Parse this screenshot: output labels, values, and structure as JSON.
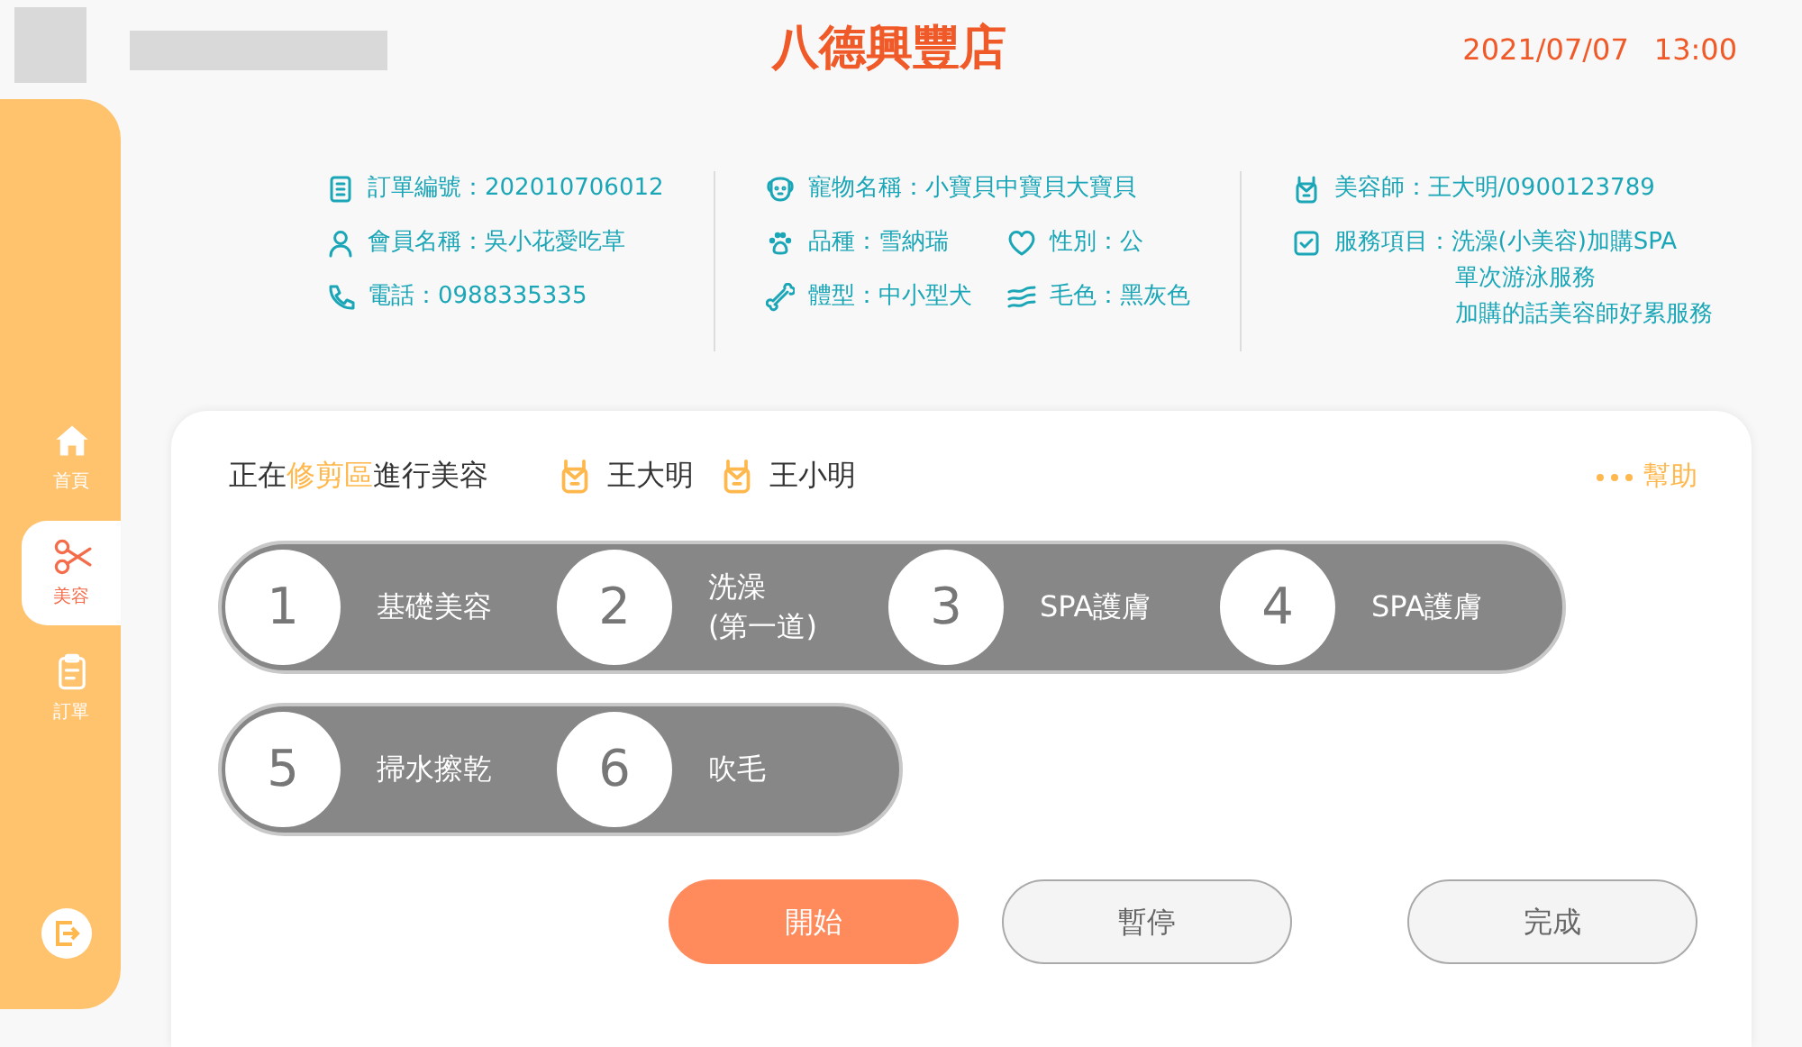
{
  "header": {
    "store_name": "八德興豐店",
    "date": "2021/07/07",
    "time": "13:00"
  },
  "sidebar": {
    "items": [
      {
        "label": "首頁",
        "kind": "home",
        "selected": false
      },
      {
        "label": "美容",
        "kind": "scissors",
        "selected": true
      },
      {
        "label": "訂單",
        "kind": "clipboard",
        "selected": false
      }
    ]
  },
  "info": {
    "columns": [
      [
        {
          "kind": "document",
          "label": "訂單編號：",
          "value": "202010706012"
        },
        {
          "kind": "person",
          "label": "會員名稱：",
          "value": "吳小花愛吃草"
        },
        {
          "kind": "phone",
          "label": "電話：",
          "value": "0988335335"
        }
      ],
      [
        {
          "kind": "dog",
          "label": "寵物名稱：",
          "value": "小寶貝中寶貝大寶貝"
        },
        {
          "kind": "paw",
          "label": "品種：",
          "value": "雪納瑞"
        },
        {
          "kind": "heart",
          "label": "性別：",
          "value": "公"
        },
        {
          "kind": "bone",
          "label": "體型：",
          "value": "中小型犬"
        },
        {
          "kind": "waves",
          "label": "毛色：",
          "value": "黑灰色"
        }
      ],
      [
        {
          "kind": "badge",
          "label": "美容師：",
          "value": "王大明/0900123789"
        },
        {
          "kind": "check",
          "label": "服務項目：",
          "value": "洗澡(小美容)加購SPA",
          "extra": [
            "單次游泳服務",
            "加購的話美容師好累服務"
          ]
        }
      ]
    ]
  },
  "status": {
    "prefix": "正在",
    "area": "修剪區",
    "suffix": "進行美容",
    "groomers": [
      "王大明",
      "王小明"
    ],
    "help": "幫助"
  },
  "steps": [
    [
      {
        "number": "1",
        "label": [
          "基礎美容"
        ]
      },
      {
        "number": "2",
        "label": [
          "洗澡",
          "(第一道)"
        ]
      },
      {
        "number": "3",
        "label": [
          "SPA護膚"
        ]
      },
      {
        "number": "4",
        "label": [
          "SPA護膚"
        ]
      }
    ],
    [
      {
        "number": "5",
        "label": [
          "掃水擦乾"
        ]
      },
      {
        "number": "6",
        "label": [
          "吹毛"
        ]
      }
    ]
  ],
  "buttons": [
    {
      "label": "開始",
      "kind": "primary"
    },
    {
      "label": "暫停",
      "kind": "secondary"
    },
    {
      "label": "完成",
      "kind": "secondary"
    }
  ]
}
